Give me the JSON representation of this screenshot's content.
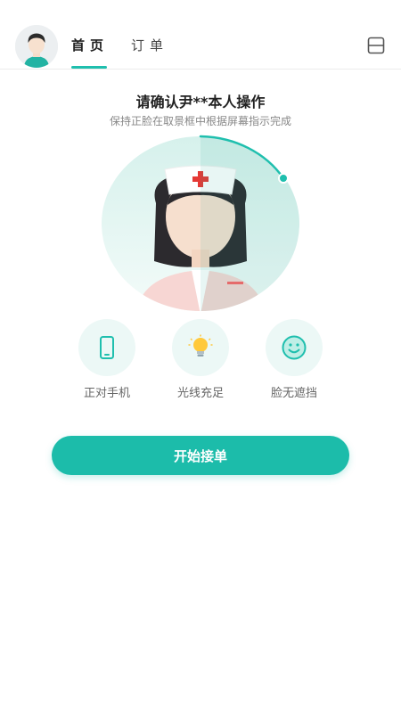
{
  "header": {
    "tabs": [
      {
        "label": "首页",
        "active": true
      },
      {
        "label": "订单",
        "active": false
      }
    ],
    "avatar_icon": "user-avatar-icon",
    "menu_icon": "switch-layout-icon"
  },
  "verify": {
    "title": "请确认尹**本人操作",
    "subtitle": "保持正脸在取景框中根据屏幕指示完成"
  },
  "tips": [
    {
      "label": "正对手机",
      "icon": "phone-icon"
    },
    {
      "label": "光线充足",
      "icon": "lightbulb-icon"
    },
    {
      "label": "脸无遮挡",
      "icon": "smile-icon"
    }
  ],
  "actions": {
    "start_label": "开始接单"
  },
  "colors": {
    "accent": "#1cbcaa",
    "tip_bg": "#ecf8f6",
    "nurse_cap_cross": "#e53935"
  }
}
